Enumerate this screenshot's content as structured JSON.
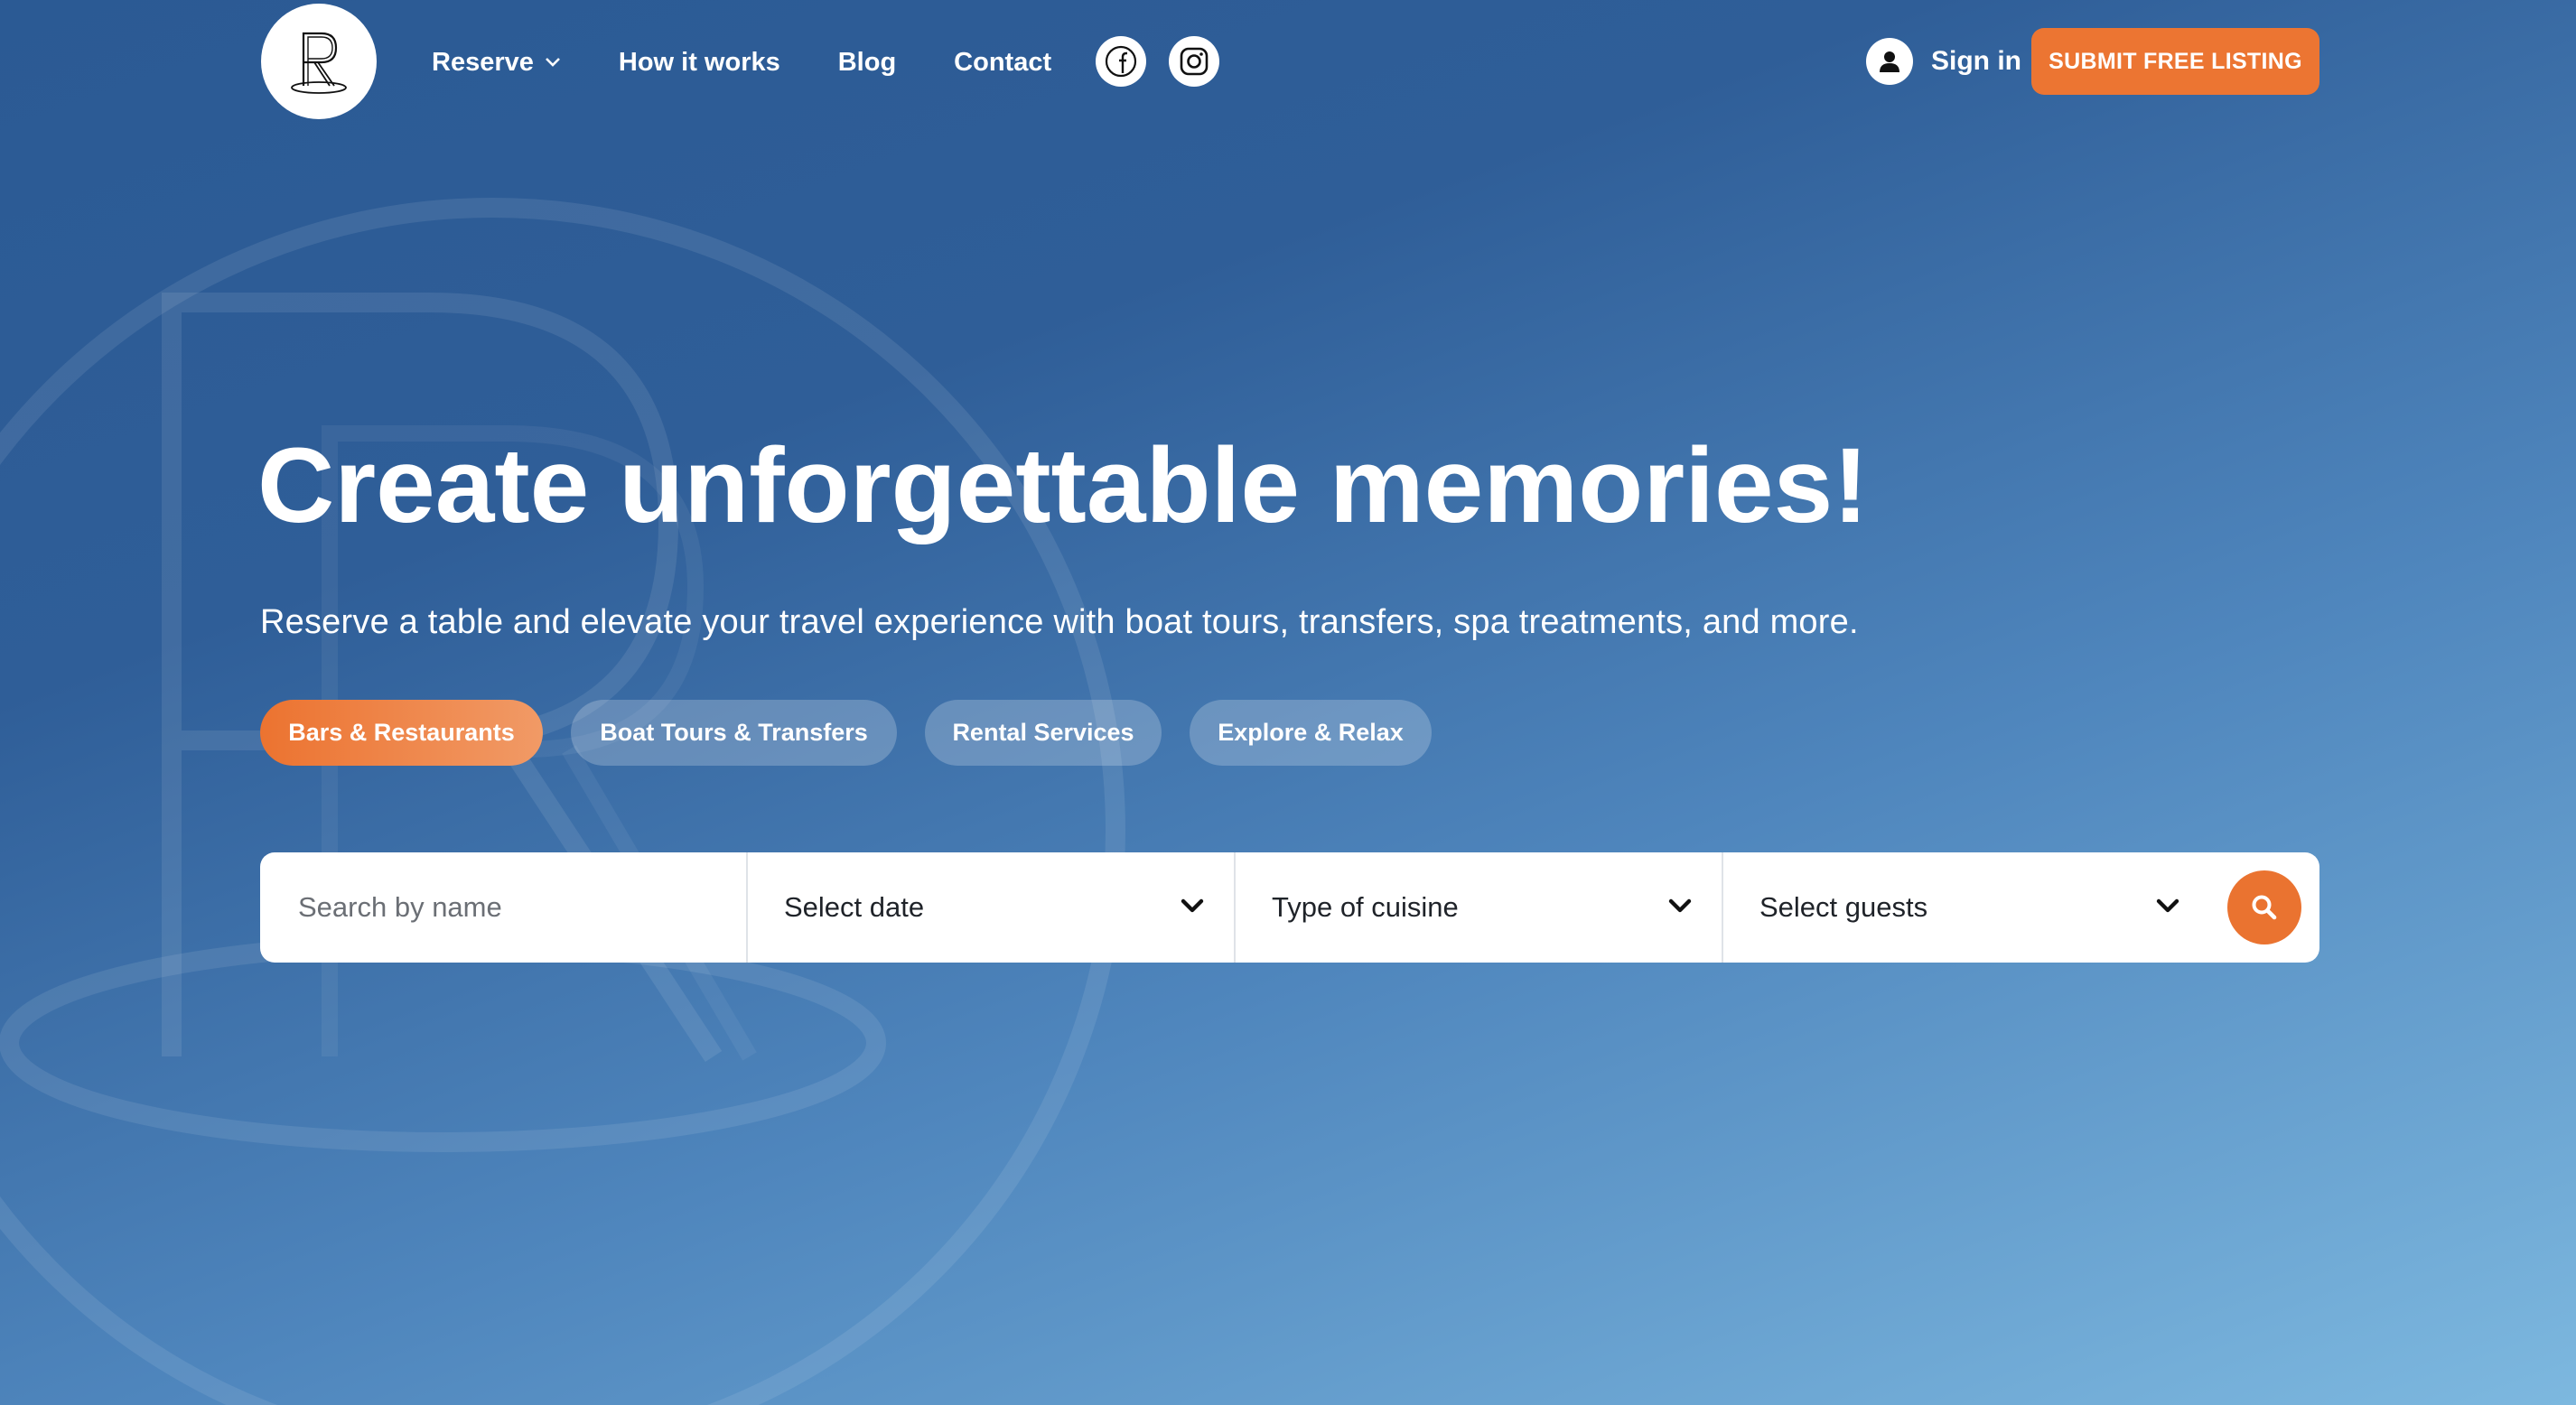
{
  "brand": {
    "logo_letter": "R"
  },
  "nav": {
    "items": [
      {
        "label": "Reserve",
        "has_dropdown": true
      },
      {
        "label": "How it works"
      },
      {
        "label": "Blog"
      },
      {
        "label": "Contact"
      }
    ],
    "social": [
      "facebook-icon",
      "instagram-icon"
    ]
  },
  "header": {
    "signin_label": "Sign in",
    "submit_label": "SUBMIT FREE LISTING"
  },
  "hero": {
    "title": "Create unforgettable memories!",
    "subtitle": "Reserve a table and elevate your travel experience with boat tours, transfers, spa treatments, and more."
  },
  "categories": [
    {
      "label": "Bars & Restaurants",
      "active": true
    },
    {
      "label": "Boat Tours & Transfers",
      "active": false
    },
    {
      "label": "Rental Services",
      "active": false
    },
    {
      "label": "Explore & Relax",
      "active": false
    }
  ],
  "search": {
    "name_placeholder": "Search by name",
    "date_label": "Select date",
    "cuisine_label": "Type of cuisine",
    "guests_label": "Select guests"
  },
  "colors": {
    "accent": "#EC7532",
    "bg_top": "#2B5A94",
    "bg_bottom": "#7DB8DF"
  }
}
